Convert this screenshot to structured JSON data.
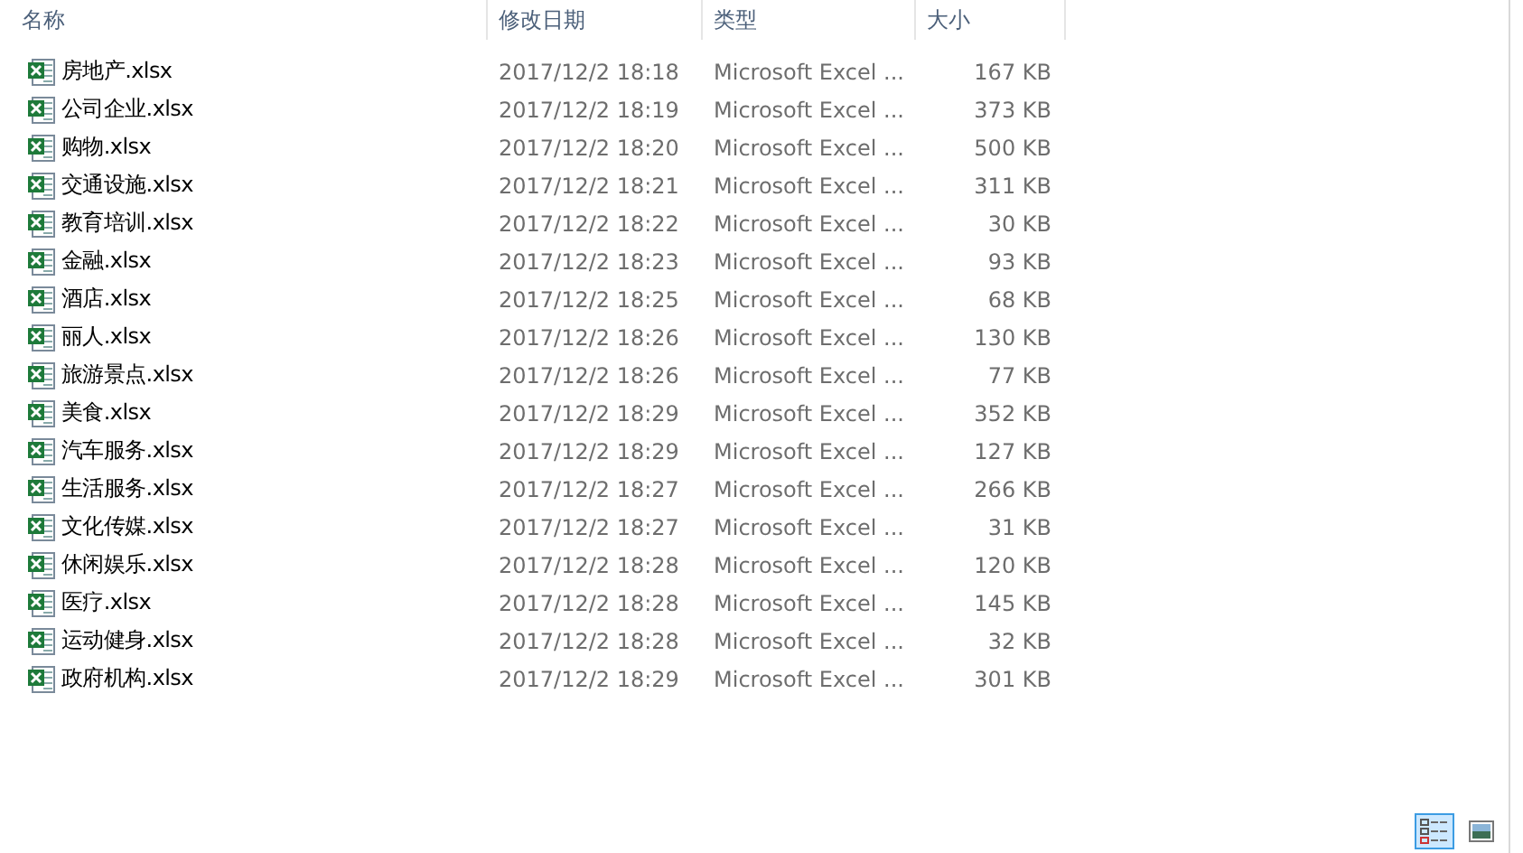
{
  "columns": [
    "名称",
    "修改日期",
    "类型",
    "大小"
  ],
  "files": [
    {
      "name": "房地产.xlsx",
      "modified": "2017/12/2 18:18",
      "type": "Microsoft Excel ...",
      "size": "167 KB"
    },
    {
      "name": "公司企业.xlsx",
      "modified": "2017/12/2 18:19",
      "type": "Microsoft Excel ...",
      "size": "373 KB"
    },
    {
      "name": "购物.xlsx",
      "modified": "2017/12/2 18:20",
      "type": "Microsoft Excel ...",
      "size": "500 KB"
    },
    {
      "name": "交通设施.xlsx",
      "modified": "2017/12/2 18:21",
      "type": "Microsoft Excel ...",
      "size": "311 KB"
    },
    {
      "name": "教育培训.xlsx",
      "modified": "2017/12/2 18:22",
      "type": "Microsoft Excel ...",
      "size": "30 KB"
    },
    {
      "name": "金融.xlsx",
      "modified": "2017/12/2 18:23",
      "type": "Microsoft Excel ...",
      "size": "93 KB"
    },
    {
      "name": "酒店.xlsx",
      "modified": "2017/12/2 18:25",
      "type": "Microsoft Excel ...",
      "size": "68 KB"
    },
    {
      "name": "丽人.xlsx",
      "modified": "2017/12/2 18:26",
      "type": "Microsoft Excel ...",
      "size": "130 KB"
    },
    {
      "name": "旅游景点.xlsx",
      "modified": "2017/12/2 18:26",
      "type": "Microsoft Excel ...",
      "size": "77 KB"
    },
    {
      "name": "美食.xlsx",
      "modified": "2017/12/2 18:29",
      "type": "Microsoft Excel ...",
      "size": "352 KB"
    },
    {
      "name": "汽车服务.xlsx",
      "modified": "2017/12/2 18:29",
      "type": "Microsoft Excel ...",
      "size": "127 KB"
    },
    {
      "name": "生活服务.xlsx",
      "modified": "2017/12/2 18:27",
      "type": "Microsoft Excel ...",
      "size": "266 KB"
    },
    {
      "name": "文化传媒.xlsx",
      "modified": "2017/12/2 18:27",
      "type": "Microsoft Excel ...",
      "size": "31 KB"
    },
    {
      "name": "休闲娱乐.xlsx",
      "modified": "2017/12/2 18:28",
      "type": "Microsoft Excel ...",
      "size": "120 KB"
    },
    {
      "name": "医疗.xlsx",
      "modified": "2017/12/2 18:28",
      "type": "Microsoft Excel ...",
      "size": "145 KB"
    },
    {
      "name": "运动健身.xlsx",
      "modified": "2017/12/2 18:28",
      "type": "Microsoft Excel ...",
      "size": "32 KB"
    },
    {
      "name": "政府机构.xlsx",
      "modified": "2017/12/2 18:29",
      "type": "Microsoft Excel ...",
      "size": "301 KB"
    }
  ],
  "view_buttons": [
    {
      "kind": "details",
      "selected": true
    },
    {
      "kind": "large_icons",
      "selected": false
    }
  ]
}
